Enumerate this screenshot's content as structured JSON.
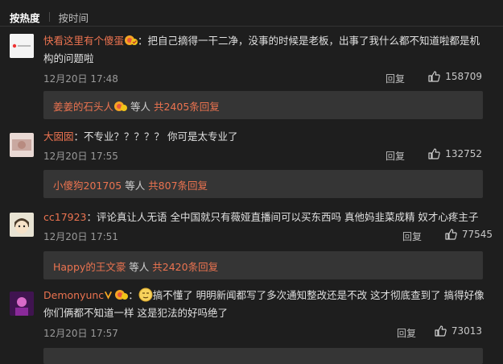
{
  "sort": {
    "tab_hot": "按热度",
    "tab_time": "按时间"
  },
  "comments": [
    {
      "user": "快看这里有个傻蛋",
      "text": "：把自己摘得一干二净，没事的时候是老板，出事了我什么都不知道啦都是机构的问题啦",
      "time": "12月20日 17:48",
      "reply": "回复",
      "likes": "158709",
      "sub_user": "姜姜的石头人",
      "sub_mid": " 等人 ",
      "sub_count": "共2405条回复"
    },
    {
      "user": "大囡囡",
      "text": "：不专业？？？？？ 你可是太专业了",
      "time": "12月20日 17:55",
      "reply": "回复",
      "likes": "132752",
      "sub_user": "小傻狗201705",
      "sub_mid": " 等人 ",
      "sub_count": "共807条回复"
    },
    {
      "user": "cc17923",
      "text": "：评论真让人无语  全中国就只有薇娅直播间可以买东西吗 真他妈韭菜成精 奴才心疼主子",
      "time": "12月20日 17:51",
      "reply": "回复",
      "likes": "77545",
      "sub_user": "Happy的王文豪",
      "sub_mid": " 等人 ",
      "sub_count": "共2420条回复"
    },
    {
      "user": "Demonyunc",
      "text": "搞不懂了 明明新闻都写了多次通知整改还是不改 这才彻底查到了 搞得好像你们俩都不知道一样 这是犯法的好吗绝了",
      "time": "12月20日 17:57",
      "reply": "回复",
      "likes": "73013"
    }
  ],
  "colors": {
    "accent": "#eb7350",
    "background": "#1e1e1e",
    "sub_background": "#353535"
  }
}
